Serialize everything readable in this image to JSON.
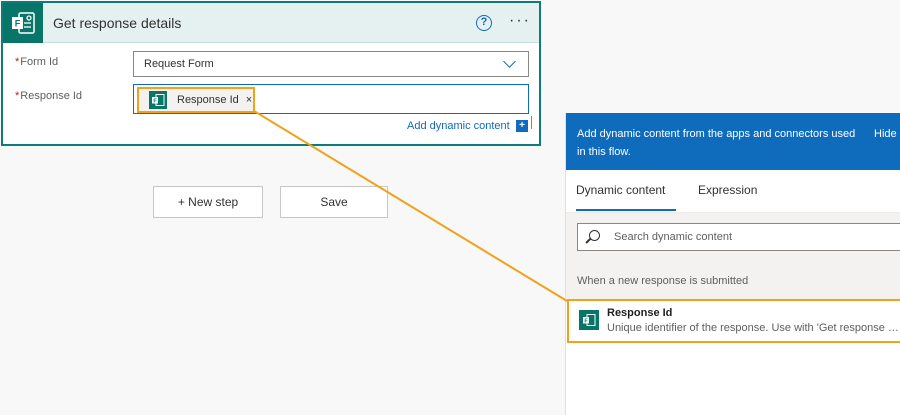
{
  "card": {
    "title": "Get response details",
    "icon": "forms-icon",
    "help_icon": "?",
    "more_icon": "···",
    "fields": {
      "form_id": {
        "label": "Form Id",
        "required_mark": "*",
        "value": "Request Form"
      },
      "response_id": {
        "label": "Response Id",
        "required_mark": "*",
        "token_label": "Response Id",
        "token_close": "×"
      }
    },
    "add_dynamic_content": "Add dynamic content",
    "add_dynamic_icon": "+"
  },
  "steps": {
    "new_step": "+ New step",
    "save": "Save"
  },
  "panel": {
    "description": "Add dynamic content from the apps and connectors used in this flow.",
    "hide": "Hide",
    "tabs": [
      {
        "label": "Dynamic content",
        "active": true
      },
      {
        "label": "Expression",
        "active": false
      }
    ],
    "search_placeholder": "Search dynamic content",
    "group_title": "When a new response is submitted",
    "items": [
      {
        "title": "Response Id",
        "description": "Unique identifier of the response. Use with 'Get response de..."
      }
    ]
  },
  "colors": {
    "accent": "#0f6cbd",
    "forms_green": "#077568",
    "highlight": "#f0a21a",
    "card_border": "#0e7c7b"
  }
}
